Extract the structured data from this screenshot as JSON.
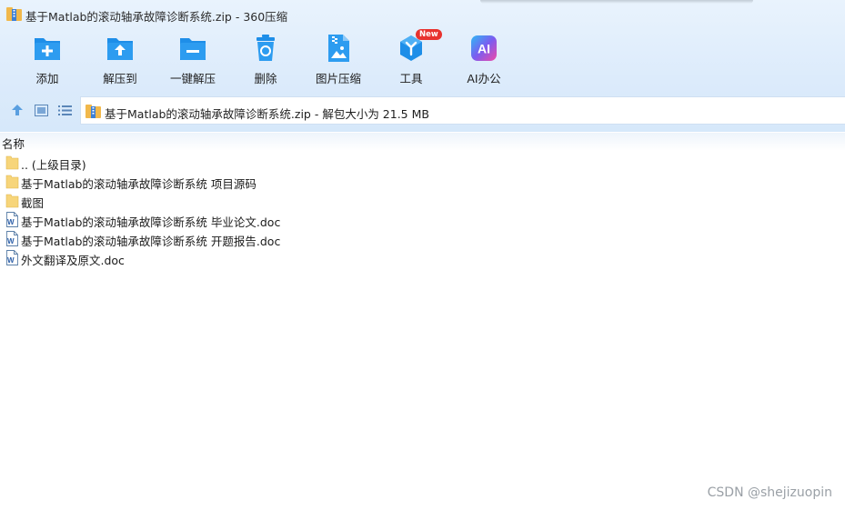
{
  "window": {
    "title": "基于Matlab的滚动轴承故障诊断系统.zip - 360压缩"
  },
  "toolbar": {
    "items": [
      {
        "label": "添加",
        "icon": "add-icon"
      },
      {
        "label": "解压到",
        "icon": "extract-to-icon"
      },
      {
        "label": "一键解压",
        "icon": "one-click-extract-icon"
      },
      {
        "label": "删除",
        "icon": "delete-icon"
      },
      {
        "label": "图片压缩",
        "icon": "image-compress-icon"
      },
      {
        "label": "工具",
        "icon": "tools-icon",
        "badge": "New"
      },
      {
        "label": "AI办公",
        "icon": "ai-office-icon",
        "glyph": "AI"
      }
    ]
  },
  "nav": {
    "address": "基于Matlab的滚动轴承故障诊断系统.zip - 解包大小为 21.5 MB"
  },
  "list": {
    "column_name": "名称",
    "rows": [
      {
        "name": ".. (上级目录)",
        "icon": "folder-icon"
      },
      {
        "name": "基于Matlab的滚动轴承故障诊断系统 项目源码",
        "icon": "folder-icon"
      },
      {
        "name": "截图",
        "icon": "folder-icon"
      },
      {
        "name": "基于Matlab的滚动轴承故障诊断系统 毕业论文.doc",
        "icon": "word-doc-icon"
      },
      {
        "name": "基于Matlab的滚动轴承故障诊断系统 开题报告.doc",
        "icon": "word-doc-icon"
      },
      {
        "name": "外文翻译及原文.doc",
        "icon": "word-doc-icon"
      }
    ]
  },
  "watermark": "CSDN @shejizuopin",
  "colors": {
    "accent_blue": "#1e8ee8",
    "folder_yellow": "#f7d57a",
    "badge_red": "#e8322e"
  }
}
